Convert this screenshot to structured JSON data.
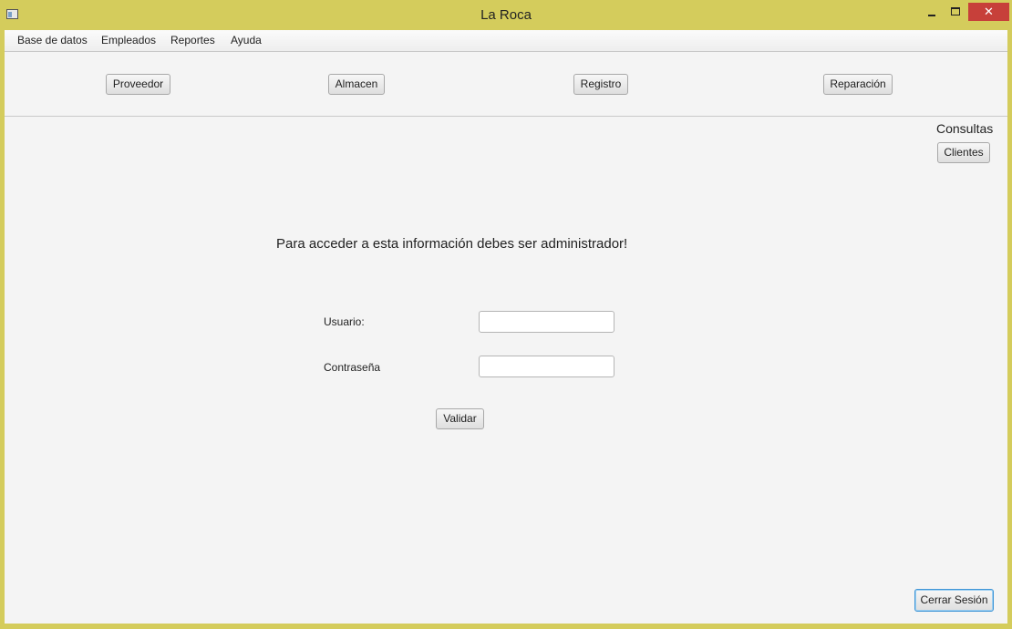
{
  "window": {
    "title": "La Roca"
  },
  "menu": [
    "Base de datos",
    "Empleados",
    "Reportes",
    "Ayuda"
  ],
  "toolbar": {
    "proveedor": "Proveedor",
    "almacen": "Almacen",
    "registro": "Registro",
    "reparacion": "Reparación"
  },
  "consultas": {
    "title": "Consultas",
    "clientes": "Clientes"
  },
  "login": {
    "message": "Para acceder a esta información debes ser administrador!",
    "usuario_label": "Usuario:",
    "usuario_value": "",
    "contrasena_label": "Contraseña",
    "contrasena_value": "",
    "validar": "Validar"
  },
  "footer": {
    "cerrar_sesion": "Cerrar Sesión"
  }
}
